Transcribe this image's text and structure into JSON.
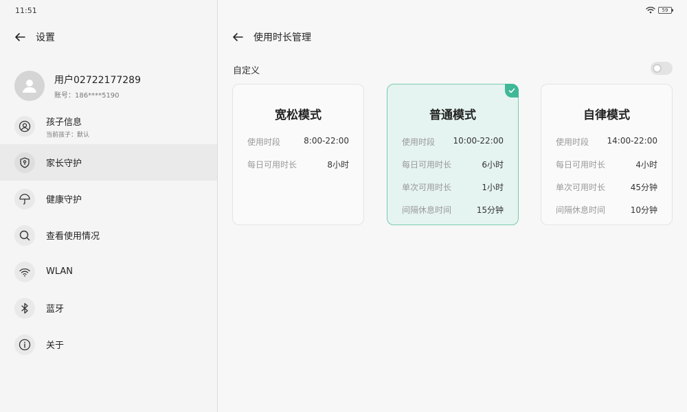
{
  "status_bar": {
    "time": "11:51",
    "battery": "59"
  },
  "left": {
    "header_title": "设置",
    "user": {
      "name": "用户02722177289",
      "account": "账号：186****5190"
    },
    "menu": [
      {
        "label": "孩子信息",
        "sub": "当前孩子：默认",
        "icon": "person-circle-icon"
      },
      {
        "label": "家长守护",
        "icon": "shield-icon",
        "active": true
      },
      {
        "label": "健康守护",
        "icon": "umbrella-icon"
      },
      {
        "label": "查看使用情况",
        "icon": "search-icon"
      },
      {
        "label": "WLAN",
        "icon": "wifi-icon"
      },
      {
        "label": "蓝牙",
        "icon": "bluetooth-icon"
      },
      {
        "label": "关于",
        "icon": "info-icon"
      }
    ]
  },
  "right": {
    "header_title": "使用时长管理",
    "section_label": "自定义",
    "toggle_on": false,
    "cards": [
      {
        "title": "宽松模式",
        "selected": false,
        "rows": [
          {
            "key": "使用时段",
            "value": "8:00-22:00"
          },
          {
            "key": "每日可用时长",
            "value": "8小时"
          }
        ]
      },
      {
        "title": "普通模式",
        "selected": true,
        "rows": [
          {
            "key": "使用时段",
            "value": "10:00-22:00"
          },
          {
            "key": "每日可用时长",
            "value": "6小时"
          },
          {
            "key": "单次可用时长",
            "value": "1小时"
          },
          {
            "key": "间隔休息时间",
            "value": "15分钟"
          }
        ]
      },
      {
        "title": "自律模式",
        "selected": false,
        "rows": [
          {
            "key": "使用时段",
            "value": "14:00-22:00"
          },
          {
            "key": "每日可用时长",
            "value": "4小时"
          },
          {
            "key": "单次可用时长",
            "value": "45分钟"
          },
          {
            "key": "间隔休息时间",
            "value": "10分钟"
          }
        ]
      }
    ]
  },
  "colors": {
    "accent": "#3fb898",
    "selected_bg": "#e5f4f0",
    "selected_border": "#77c9ae"
  }
}
